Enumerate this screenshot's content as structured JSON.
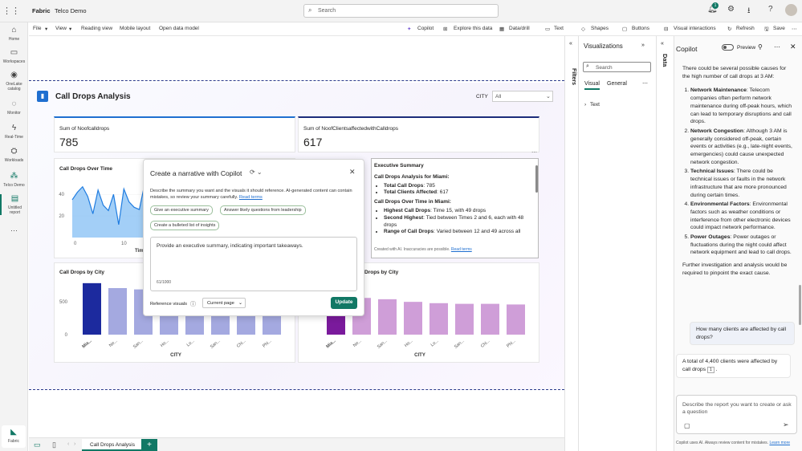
{
  "topbar": {
    "app": "Fabric",
    "workspace": "Telco Demo",
    "search_placeholder": "Search",
    "notif_count": "1"
  },
  "rail": [
    {
      "label": "Home",
      "icon": "home-icon"
    },
    {
      "label": "Workspaces",
      "icon": "workspaces-icon"
    },
    {
      "label": "OneLake catalog",
      "icon": "onelake-icon"
    },
    {
      "label": "Monitor",
      "icon": "monitor-icon"
    },
    {
      "label": "Real-Time",
      "icon": "realtime-icon"
    },
    {
      "label": "Workloads",
      "icon": "workloads-icon"
    },
    {
      "label": "Telco Demo",
      "icon": "workspace-icon"
    },
    {
      "label": "Untitled report",
      "icon": "report-icon"
    }
  ],
  "rail_bottom": "Fabric",
  "ribbon": {
    "file": "File",
    "view": "View",
    "reading": "Reading view",
    "mobile": "Mobile layout",
    "open_model": "Open data model",
    "copilot": "Copilot",
    "explore": "Explore this data",
    "datadrill": "Data/drill",
    "textbox": "Text box",
    "shapes": "Shapes",
    "buttons": "Buttons",
    "visint": "Visual interactions",
    "refresh": "Refresh",
    "save": "Save"
  },
  "report": {
    "title": "Call Drops Analysis",
    "slicer_label": "CITY",
    "slicer_value": "All"
  },
  "kpi1": {
    "label": "Sum of Noofcalldrops",
    "value": "785"
  },
  "kpi2": {
    "label": "Sum of NoofClientsaffectedwithCalldrops",
    "value": "617"
  },
  "line_chart": {
    "title": "Call Drops Over Time"
  },
  "bar1": {
    "title": "Call Drops by City",
    "xlabel": "CITY"
  },
  "bar2": {
    "title": "Drops by City",
    "xlabel": "CITY"
  },
  "chart_data": [
    {
      "type": "line",
      "title": "Call Drops Over Time",
      "x": [
        1,
        2,
        3,
        4,
        5,
        6,
        7,
        8,
        9,
        10,
        11,
        12,
        13,
        14,
        15
      ],
      "y": [
        35,
        42,
        47,
        38,
        22,
        44,
        30,
        25,
        40,
        12,
        45,
        33,
        28,
        26,
        49
      ],
      "yticks": [
        "20",
        "40"
      ],
      "xticks": [
        "0",
        "10"
      ],
      "xlabel": "Tim"
    },
    {
      "type": "bar",
      "title": "Call Drops by City",
      "categories": [
        "Mia...",
        "Ne...",
        "San...",
        "Ho...",
        "Lo...",
        "San...",
        "Chi...",
        "Phi..."
      ],
      "values": [
        785,
        710,
        690,
        560,
        560,
        560,
        550,
        550
      ],
      "yticks": [
        "0",
        "500"
      ],
      "xlabel": "CITY"
    },
    {
      "type": "bar",
      "title": "Drops by City",
      "categories": [
        "Mia...",
        "Ne...",
        "San...",
        "Ho...",
        "Lo...",
        "San...",
        "Chi...",
        "Phi..."
      ],
      "values": [
        617,
        560,
        540,
        500,
        480,
        470,
        470,
        460
      ],
      "xlabel": "CITY"
    }
  ],
  "narrative": {
    "title": "Create a narrative with Copilot",
    "desc": "Describe the summary you want and the visuals it should reference. AI-generated content can contain mistakes, so review your summary carefully.",
    "terms": "Read terms",
    "pill1": "Give an executive summary",
    "pill2": "Answer likely questions from leadership",
    "pill3": "Create a bulleted list of insights",
    "prompt": "Provide an executive summary, indicating important takeaways.",
    "counter": "61/1000",
    "ref_label": "Reference visuals",
    "ref_value": "Current page",
    "update": "Update"
  },
  "exec": {
    "heading": "Executive Summary",
    "sub1": "Call Drops Analysis for Miami:",
    "b1_label": "Total Call Drops",
    "b1_val": ": 785",
    "b2_label": "Total Clients Affected",
    "b2_val": ": 617",
    "sub2": "Call Drops Over Time in Miami:",
    "b3_label": "Highest Call Drops",
    "b3_val": ": Time 15, with 49 drops",
    "b4_label": "Second Highest",
    "b4_val": ": Tied between Times 2 and 6, each with 48 drops",
    "b5_label": "Range of Call Drops",
    "b5_val": ": Varied between 12 and 49 across all",
    "footer": "Created with AI. Inaccuracies are possible.",
    "footer_link": "Read terms"
  },
  "viz": {
    "title": "Visualizations",
    "search": "Search",
    "tab1": "Visual",
    "tab2": "General",
    "section": "Text",
    "filters": "Filters",
    "data": "Data"
  },
  "copilot": {
    "title": "Copilot",
    "preview": "Preview",
    "intro": "There could be several possible causes for the high number of call drops at 3 AM:",
    "items": [
      {
        "head": "Network Maintenance",
        "body": ": Telecom companies often perform network maintenance during off-peak hours, which can lead to temporary disruptions and call drops."
      },
      {
        "head": "Network Congestion",
        "body": ": Although 3 AM is generally considered off-peak, certain events or activities (e.g., late-night events, emergencies) could cause unexpected network congestion."
      },
      {
        "head": "Technical Issues",
        "body": ": There could be technical issues or faults in the network infrastructure that are more pronounced during certain times."
      },
      {
        "head": "Environmental Factors",
        "body": ": Environmental factors such as weather conditions or interference from other electronic devices could impact network performance."
      },
      {
        "head": "Power Outages",
        "body": ": Power outages or fluctuations during the night could affect network equipment and lead to call drops."
      }
    ],
    "outro": "Further investigation and analysis would be required to pinpoint the exact cause.",
    "user_q": "How many clients are affected by call drops?",
    "answer": "A total of 4,400 clients were affected by call drops",
    "input_placeholder": "Describe the report you want to create or ask a question",
    "disclaimer": "Copilot uses AI. Always review content for mistakes.",
    "learn": "Learn more"
  },
  "pagetabs": {
    "tab": "Call Drops Analysis",
    "add": "+"
  }
}
